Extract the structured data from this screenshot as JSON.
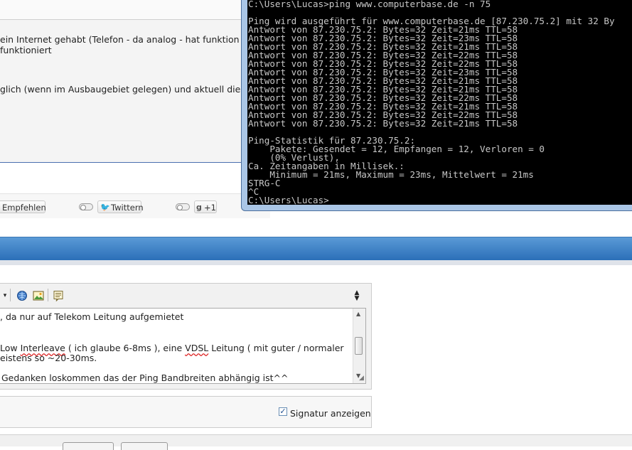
{
  "post": {
    "line1": "ein Internet gehabt (Telefon - da analog - hat funktion",
    "line2": "funktioniert",
    "line3": "glich (wenn im Ausbaugebiet gelegen) und aktuell die ("
  },
  "share": {
    "empfehlen_label": "Empfehlen",
    "twittern_label": "Twittern",
    "plusone_label": "+1"
  },
  "editor": {
    "text_line1": ", da nur auf Telekom Leitung aufgemietet",
    "text_line2_pre": "Low ",
    "text_line2_interleave": "Interleave",
    "text_line2_mid": " ( ich glaube 6-8ms ), eine ",
    "text_line2_vdsl": "VDSL",
    "text_line2_post": " Leitung ( mit guter / normaler",
    "text_line3": "eistens so ~20-30ms.",
    "text_line4": "Gedanken loskommen das der Ping Bandbreiten abhängig ist^^",
    "signature_label": "Signatur anzeigen",
    "signature_checked": true
  },
  "cmd": {
    "lines": [
      "C:\\Users\\Lucas>ping www.computerbase.de -n 75",
      "",
      "Ping wird ausgeführt für www.computerbase.de [87.230.75.2] mit 32 By",
      "Antwort von 87.230.75.2: Bytes=32 Zeit=21ms TTL=58",
      "Antwort von 87.230.75.2: Bytes=32 Zeit=23ms TTL=58",
      "Antwort von 87.230.75.2: Bytes=32 Zeit=21ms TTL=58",
      "Antwort von 87.230.75.2: Bytes=32 Zeit=22ms TTL=58",
      "Antwort von 87.230.75.2: Bytes=32 Zeit=22ms TTL=58",
      "Antwort von 87.230.75.2: Bytes=32 Zeit=23ms TTL=58",
      "Antwort von 87.230.75.2: Bytes=32 Zeit=21ms TTL=58",
      "Antwort von 87.230.75.2: Bytes=32 Zeit=21ms TTL=58",
      "Antwort von 87.230.75.2: Bytes=32 Zeit=22ms TTL=58",
      "Antwort von 87.230.75.2: Bytes=32 Zeit=21ms TTL=58",
      "Antwort von 87.230.75.2: Bytes=32 Zeit=22ms TTL=58",
      "Antwort von 87.230.75.2: Bytes=32 Zeit=21ms TTL=58",
      "",
      "Ping-Statistik für 87.230.75.2:",
      "    Pakete: Gesendet = 12, Empfangen = 12, Verloren = 0",
      "    (0% Verlust),",
      "Ca. Zeitangaben in Millisek.:",
      "    Minimum = 21ms, Maximum = 23ms, Mittelwert = 21ms",
      "STRG-C",
      "^C",
      "C:\\Users\\Lucas>"
    ]
  },
  "colors": {
    "accent_blue": "#2b6fb8",
    "console_bg": "#000000",
    "console_text": "#c8c8c8"
  }
}
